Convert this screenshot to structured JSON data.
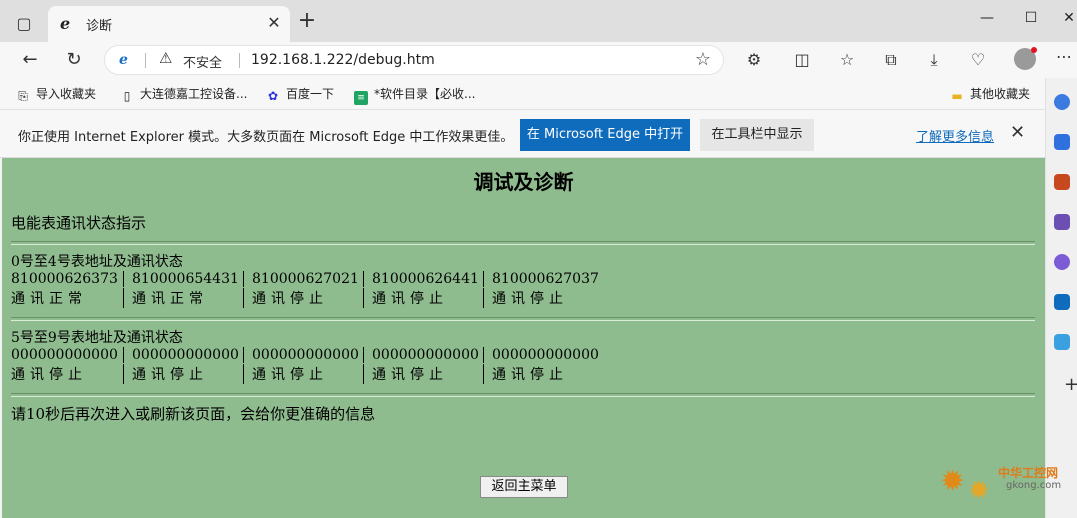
{
  "browser": {
    "tab_title": "诊断",
    "url": "192.168.1.222/debug.htm",
    "insecure_label": "不安全",
    "favorites": [
      {
        "label": "导入收藏夹",
        "icon": "import-favorites-icon"
      },
      {
        "label": "大连德嘉工控设备...",
        "icon": "page-icon"
      },
      {
        "label": "百度一下",
        "icon": "baidu-paw-icon"
      },
      {
        "label": "*软件目录【必收...",
        "icon": "sheet-icon"
      },
      {
        "label": "其他收藏夹",
        "icon": "folder-icon"
      }
    ],
    "ie_banner": {
      "message": "你正使用 Internet Explorer 模式。大多数页面在 Microsoft Edge 中工作效果更佳。",
      "open_button": "在 Microsoft Edge 中打开",
      "toolbar_button": "在工具栏中显示",
      "learn_more": "了解更多信息"
    }
  },
  "page": {
    "title": "调试及诊断",
    "section_heading": "电能表通讯状态指示",
    "groups": [
      {
        "title": "0号至4号表地址及通讯状态",
        "addresses": [
          "810000626373",
          "810000654431",
          "810000627021",
          "810000626441",
          "810000627037"
        ],
        "statuses": [
          "通讯正常",
          "通讯正常",
          "通讯停止",
          "通讯停止",
          "通讯停止"
        ]
      },
      {
        "title": "5号至9号表地址及通讯状态",
        "addresses": [
          "000000000000",
          "000000000000",
          "000000000000",
          "000000000000",
          "000000000000"
        ],
        "statuses": [
          "通讯停止",
          "通讯停止",
          "通讯停止",
          "通讯停止",
          "通讯停止"
        ]
      }
    ],
    "note": "请10秒后再次进入或刷新该页面，会给你更准确的信息",
    "back_button": "返回主菜单"
  },
  "watermark": {
    "line1": "中华工控网",
    "line2": "gkong.com"
  },
  "colors": {
    "page_background": "#8fbc8f",
    "primary_button": "#0f6cbd"
  }
}
